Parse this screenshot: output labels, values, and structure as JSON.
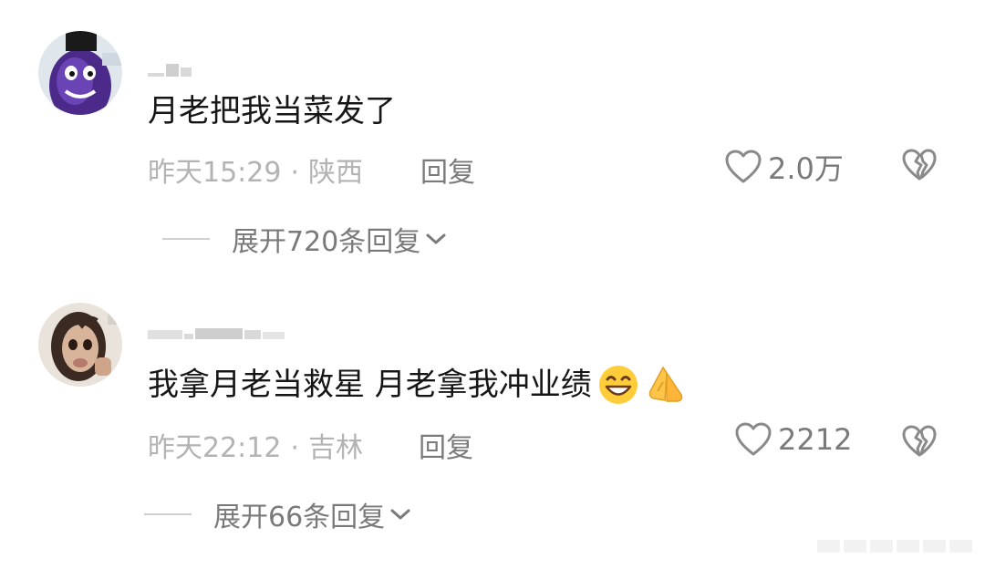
{
  "comments": [
    {
      "text": "月老把我当菜发了",
      "time": "昨天15:29",
      "location": "陕西",
      "reply_label": "回复",
      "likes": "2.0万",
      "expand_label": "展开720条回复",
      "avatar": "purple-eggplant-character-avatar"
    },
    {
      "text": "我拿月老当救星 月老拿我冲业绩",
      "emojis": [
        "grinning-squint-emoji",
        "praying-hands-emoji"
      ],
      "time": "昨天22:12",
      "location": "吉林",
      "reply_label": "回复",
      "likes": "2212",
      "expand_label": "展开66条回复",
      "avatar": "girl-photo-avatar"
    }
  ],
  "icons": {
    "like": "heart-outline-icon",
    "dislike": "broken-heart-icon",
    "expand": "chevron-down-icon"
  },
  "colors": {
    "text_primary": "#161616",
    "text_meta": "#b3b3b3",
    "text_action": "#7a7a7a"
  }
}
